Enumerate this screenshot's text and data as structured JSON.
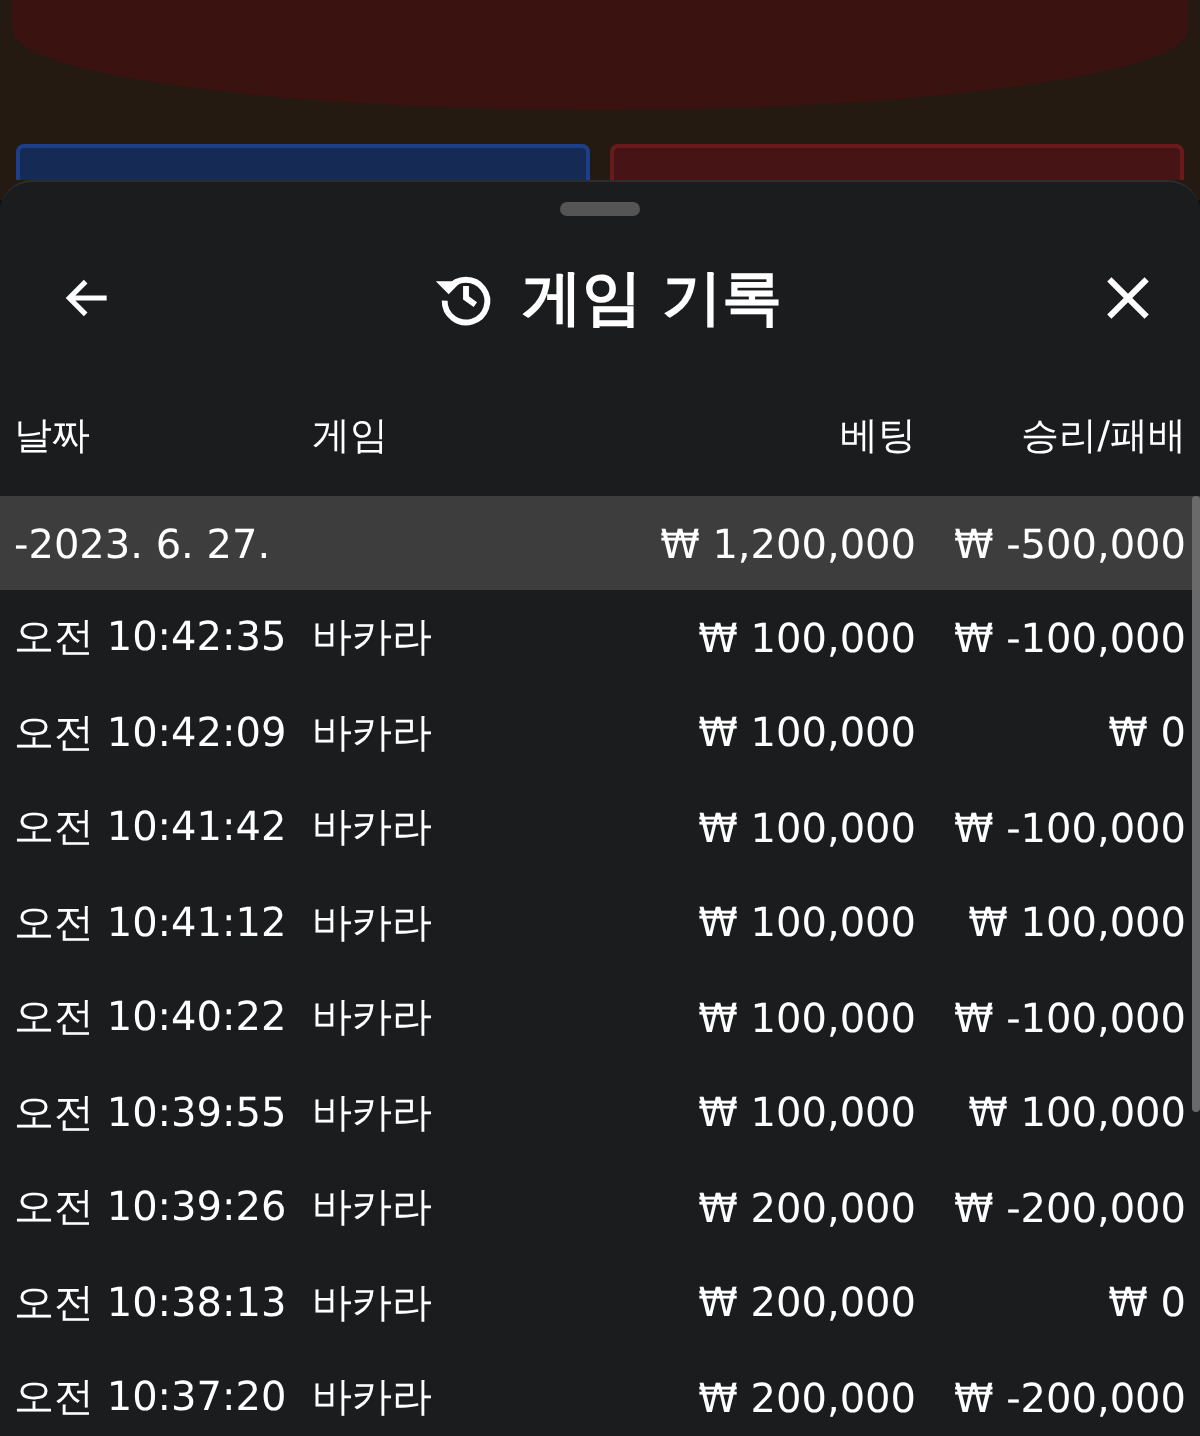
{
  "header": {
    "title": "게임 기록"
  },
  "columns": [
    "날짜",
    "게임",
    "베팅",
    "승리/패배"
  ],
  "group": {
    "date": "-2023. 6. 27.",
    "bet": "₩ 1,200,000",
    "result": "₩ -500,000"
  },
  "rows": [
    {
      "time": "오전 10:42:35",
      "game": "바카라",
      "bet": "₩ 100,000",
      "result": "₩ -100,000"
    },
    {
      "time": "오전 10:42:09",
      "game": "바카라",
      "bet": "₩ 100,000",
      "result": "₩ 0"
    },
    {
      "time": "오전 10:41:42",
      "game": "바카라",
      "bet": "₩ 100,000",
      "result": "₩ -100,000"
    },
    {
      "time": "오전 10:41:12",
      "game": "바카라",
      "bet": "₩ 100,000",
      "result": "₩ 100,000"
    },
    {
      "time": "오전 10:40:22",
      "game": "바카라",
      "bet": "₩ 100,000",
      "result": "₩ -100,000"
    },
    {
      "time": "오전 10:39:55",
      "game": "바카라",
      "bet": "₩ 100,000",
      "result": "₩ 100,000"
    },
    {
      "time": "오전 10:39:26",
      "game": "바카라",
      "bet": "₩ 200,000",
      "result": "₩ -200,000"
    },
    {
      "time": "오전 10:38:13",
      "game": "바카라",
      "bet": "₩ 200,000",
      "result": "₩ 0"
    },
    {
      "time": "오전 10:37:20",
      "game": "바카라",
      "bet": "₩ 200,000",
      "result": "₩ -200,000"
    }
  ]
}
